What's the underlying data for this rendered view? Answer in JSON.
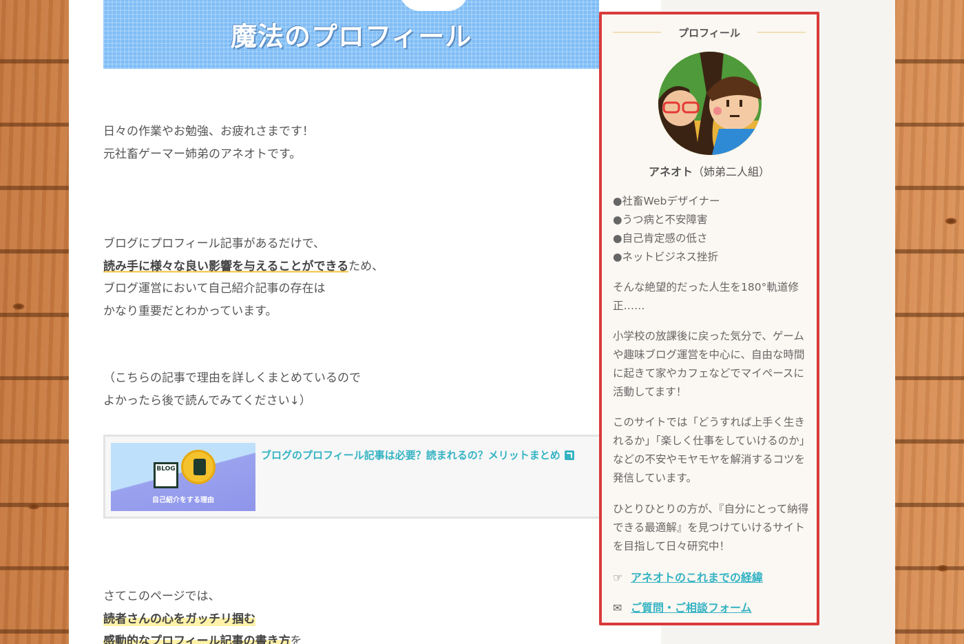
{
  "eyecatch": {
    "title": "魔法のプロフィール"
  },
  "article": {
    "p1_line1": "日々の作業やお勉強、お疲れさまです！",
    "p1_line2": "元社畜ゲーマー姉弟のアネオトです。",
    "p2_line1": "ブログにプロフィール記事があるだけで、",
    "p2_line2_mark": "読み手に様々な良い影響を与えることができる",
    "p2_line2_rest": "ため、",
    "p2_line3": "ブログ運営において自己紹介記事の存在は",
    "p2_line4": "かなり重要だとわかっています。",
    "p3_line1": "（こちらの記事で理由を詳しくまとめているので",
    "p3_line2": "よかったら後で読んでみてください↓）",
    "blogcard": {
      "thumb_label": "BLOG",
      "thumb_caption": "自己紹介をする理由",
      "title": "ブログのプロフィール記事は必要？読まれるの？メリットまとめ"
    },
    "p4_line1": "さてこのページでは、",
    "p4_line2_mark": "読者さんの心をガッチリ掴む",
    "p4_line3_mark": "感動的なプロフィール記事の書き方",
    "p4_line3_rest": "を"
  },
  "sidebar": {
    "widget_title": "プロフィール",
    "name_bold": "アネオト",
    "name_rest": "（姉弟二人組）",
    "list": [
      "●社畜Webデザイナー",
      "●うつ病と不安障害",
      "●自己肯定感の低さ",
      "●ネットビジネス挫折"
    ],
    "bio1": "そんな絶望的だった人生を180°軌道修正……",
    "bio2": "小学校の放課後に戻った気分で、ゲームや趣味ブログ運営を中心に、自由な時間に起きて家やカフェなどでマイペースに活動してます！",
    "bio3": "このサイトでは「どうすれば上手く生きれるか」「楽しく仕事をしていけるのか」などの不安やモヤモヤを解消するコツを発信しています。",
    "bio4": "ひとりひとりの方が、『自分にとって納得できる最適解』を見つけていけるサイトを目指して日々研究中！",
    "link1_icon": "thumbs-up-icon",
    "link1": "アネオトのこれまでの経緯",
    "link2_icon": "envelope-icon",
    "link2": "ご質問・ご相談フォーム"
  },
  "colors": {
    "accent_link": "#34b3c3",
    "widget_border": "#d93a3a",
    "marker_underline": "#f3c13a",
    "marker_yellow": "#fff2a8"
  }
}
